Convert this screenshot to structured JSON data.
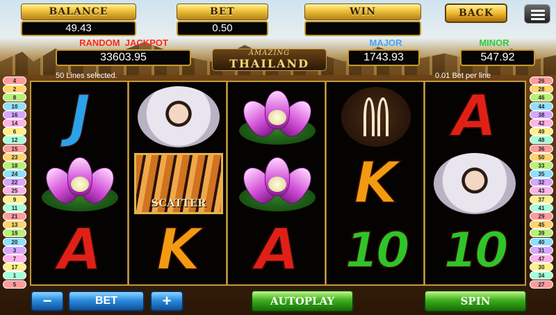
{
  "header": {
    "balance_label": "BALANCE",
    "balance_value": "49.43",
    "bet_label": "BET",
    "bet_value": "0.50",
    "win_label": "WIN",
    "win_value": "",
    "back_label": "BACK",
    "menu_icon": "hamburger-menu-icon"
  },
  "jackpots": {
    "random_label_1": "RANDOM",
    "random_label_2": "JACKPOT",
    "random_value": "33603.95",
    "major_label": "MAJOR",
    "major_value": "1743.93",
    "minor_label": "MINOR",
    "minor_value": "547.92"
  },
  "logo": {
    "line1": "AMAZING",
    "line2": "THAILAND"
  },
  "info": {
    "lines_selected": "50 Lines selected.",
    "bet_per_line": "0.01 Bet per line"
  },
  "reels": [
    [
      "J",
      "lotus",
      "A"
    ],
    [
      "lady",
      "scatter",
      "K"
    ],
    [
      "lotus",
      "lotus",
      "A"
    ],
    [
      "tusks",
      "K",
      "10"
    ],
    [
      "A",
      "lady",
      "10"
    ]
  ],
  "scatter_text": "SCATTER",
  "left_lines": [
    "4",
    "2",
    "8",
    "10",
    "16",
    "14",
    "6",
    "12",
    "15",
    "23",
    "18",
    "24",
    "22",
    "25",
    "9",
    "11",
    "21",
    "13",
    "19",
    "20",
    "3",
    "7",
    "17",
    "1",
    "5"
  ],
  "right_lines": [
    "26",
    "28",
    "46",
    "44",
    "38",
    "42",
    "49",
    "48",
    "36",
    "50",
    "33",
    "35",
    "32",
    "43",
    "37",
    "41",
    "29",
    "45",
    "39",
    "40",
    "31",
    "47",
    "30",
    "34",
    "27"
  ],
  "line_colors": [
    "#ff9b9b",
    "#ffd36e",
    "#b9f07a",
    "#8fe0ff",
    "#d7a6ff",
    "#ffb3e6",
    "#fff08a",
    "#a6ffd9"
  ],
  "controls": {
    "minus_label": "−",
    "bet_label": "BET",
    "plus_label": "+",
    "autoplay_label": "AUTOPLAY",
    "spin_label": "SPIN"
  },
  "colors": {
    "gold": "#f1c53a",
    "random_jackpot": "#ff2a1a",
    "major": "#3aa8ff",
    "minor": "#27d13a"
  }
}
